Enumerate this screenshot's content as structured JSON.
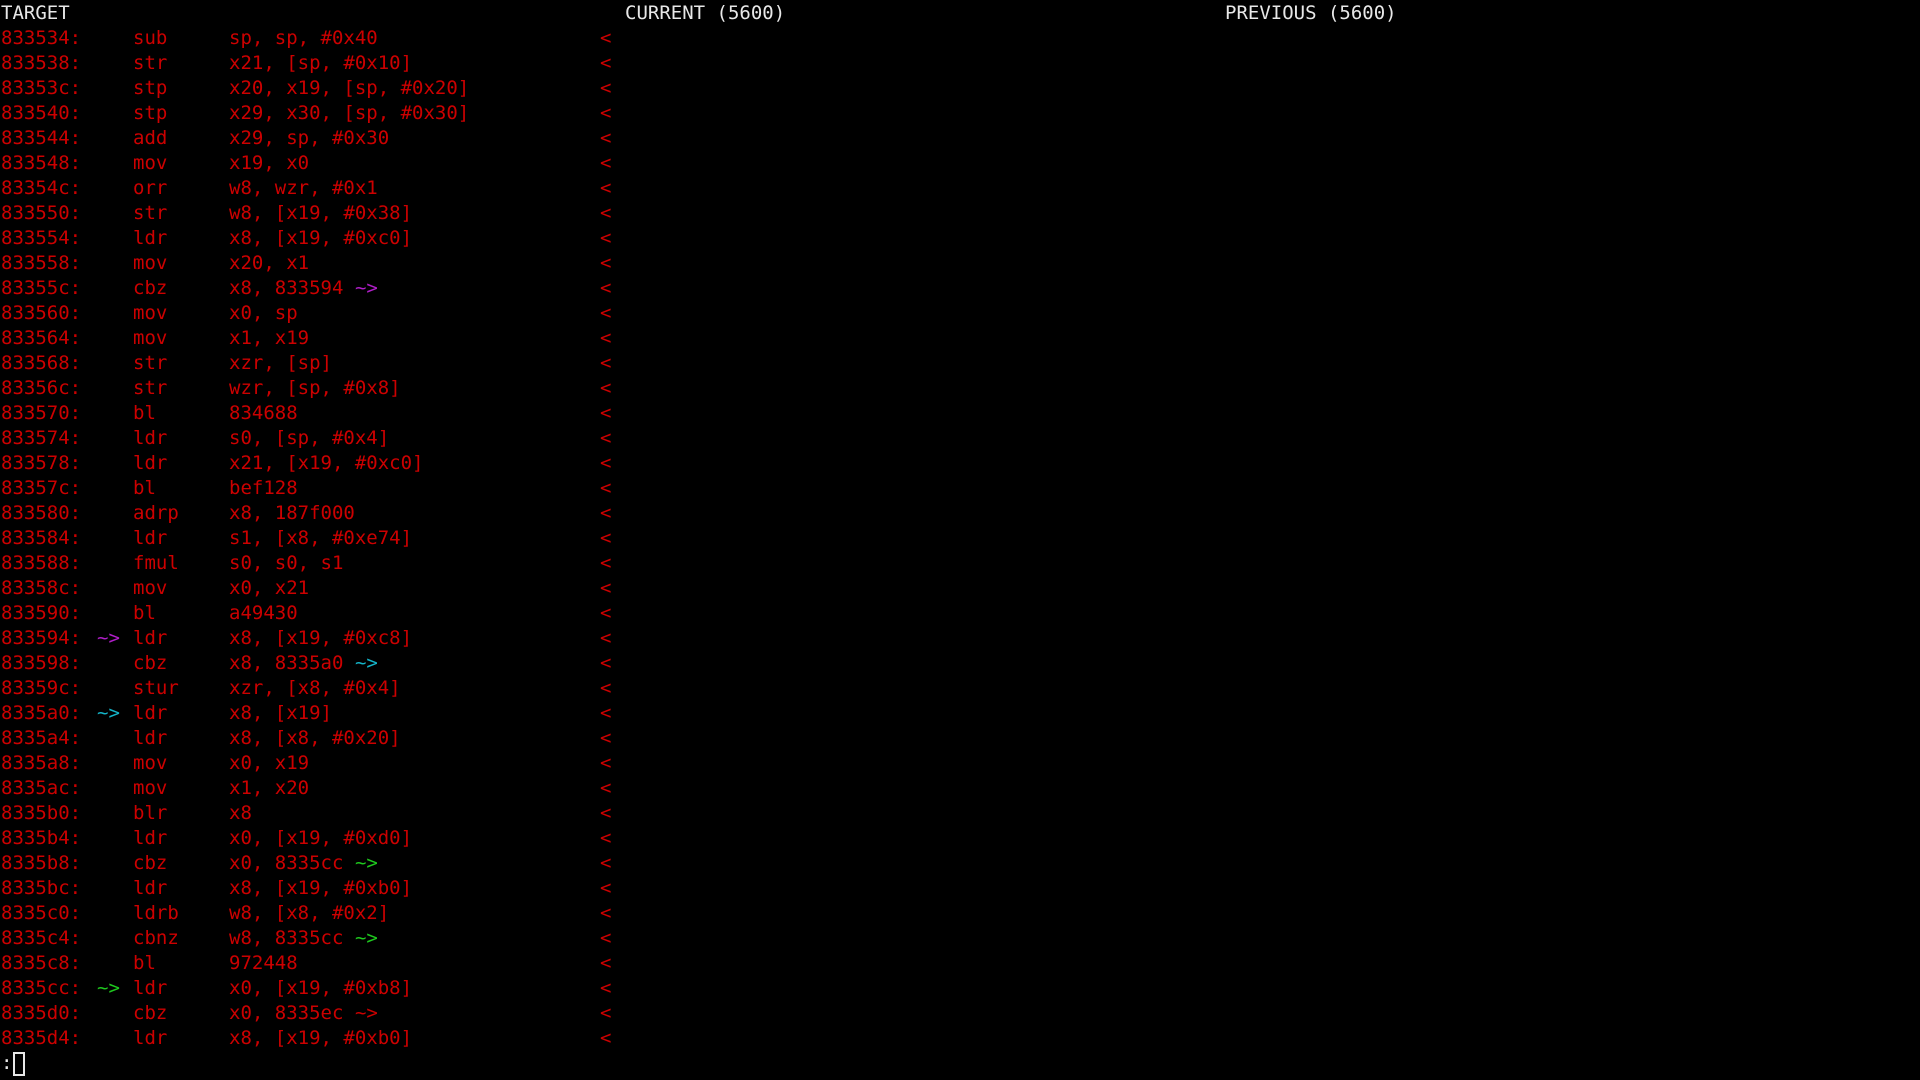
{
  "headers": {
    "target": "TARGET",
    "current": "CURRENT (5600)",
    "previous": "PREVIOUS (5600)"
  },
  "colors": {
    "text": "#cc0000",
    "header": "#e8e8e8",
    "arrow_purple": "#b01ec8",
    "arrow_cyan": "#14b4c8",
    "arrow_green": "#1ec81e"
  },
  "rows": [
    {
      "addr": "833534:",
      "mn": "sub",
      "op": "sp, sp, #0x40"
    },
    {
      "addr": "833538:",
      "mn": "str",
      "op": "x21, [sp, #0x10]"
    },
    {
      "addr": "83353c:",
      "mn": "stp",
      "op": "x20, x19, [sp, #0x20]"
    },
    {
      "addr": "833540:",
      "mn": "stp",
      "op": "x29, x30, [sp, #0x30]"
    },
    {
      "addr": "833544:",
      "mn": "add",
      "op": "x29, sp, #0x30"
    },
    {
      "addr": "833548:",
      "mn": "mov",
      "op": "x19, x0"
    },
    {
      "addr": "83354c:",
      "mn": "orr",
      "op": "w8, wzr, #0x1"
    },
    {
      "addr": "833550:",
      "mn": "str",
      "op": "w8, [x19, #0x38]"
    },
    {
      "addr": "833554:",
      "mn": "ldr",
      "op": "x8, [x19, #0xc0]"
    },
    {
      "addr": "833558:",
      "mn": "mov",
      "op": "x20, x1"
    },
    {
      "addr": "83355c:",
      "mn": "cbz",
      "op": "x8, 833594",
      "tail": " ~>",
      "tail_color": "arrow_purple"
    },
    {
      "addr": "833560:",
      "mn": "mov",
      "op": "x0, sp"
    },
    {
      "addr": "833564:",
      "mn": "mov",
      "op": "x1, x19"
    },
    {
      "addr": "833568:",
      "mn": "str",
      "op": "xzr, [sp]"
    },
    {
      "addr": "83356c:",
      "mn": "str",
      "op": "wzr, [sp, #0x8]"
    },
    {
      "addr": "833570:",
      "mn": "bl",
      "op": "834688"
    },
    {
      "addr": "833574:",
      "mn": "ldr",
      "op": "s0, [sp, #0x4]"
    },
    {
      "addr": "833578:",
      "mn": "ldr",
      "op": "x21, [x19, #0xc0]"
    },
    {
      "addr": "83357c:",
      "mn": "bl",
      "op": "bef128"
    },
    {
      "addr": "833580:",
      "mn": "adrp",
      "op": "x8, 187f000"
    },
    {
      "addr": "833584:",
      "mn": "ldr",
      "op": "s1, [x8, #0xe74]"
    },
    {
      "addr": "833588:",
      "mn": "fmul",
      "op": "s0, s0, s1"
    },
    {
      "addr": "83358c:",
      "mn": "mov",
      "op": "x0, x21"
    },
    {
      "addr": "833590:",
      "mn": "bl",
      "op": "a49430"
    },
    {
      "addr": "833594:",
      "arrow": "~>",
      "arrow_color": "arrow_purple",
      "mn": "ldr",
      "op": "x8, [x19, #0xc8]"
    },
    {
      "addr": "833598:",
      "mn": "cbz",
      "op": "x8, 8335a0",
      "tail": " ~>",
      "tail_color": "arrow_cyan"
    },
    {
      "addr": "83359c:",
      "mn": "stur",
      "op": "xzr, [x8, #0x4]"
    },
    {
      "addr": "8335a0:",
      "arrow": "~>",
      "arrow_color": "arrow_cyan",
      "mn": "ldr",
      "op": "x8, [x19]"
    },
    {
      "addr": "8335a4:",
      "mn": "ldr",
      "op": "x8, [x8, #0x20]"
    },
    {
      "addr": "8335a8:",
      "mn": "mov",
      "op": "x0, x19"
    },
    {
      "addr": "8335ac:",
      "mn": "mov",
      "op": "x1, x20"
    },
    {
      "addr": "8335b0:",
      "mn": "blr",
      "op": "x8"
    },
    {
      "addr": "8335b4:",
      "mn": "ldr",
      "op": "x0, [x19, #0xd0]"
    },
    {
      "addr": "8335b8:",
      "mn": "cbz",
      "op": "x0, 8335cc",
      "tail": " ~>",
      "tail_color": "arrow_green"
    },
    {
      "addr": "8335bc:",
      "mn": "ldr",
      "op": "x8, [x19, #0xb0]"
    },
    {
      "addr": "8335c0:",
      "mn": "ldrb",
      "op": "w8, [x8, #0x2]"
    },
    {
      "addr": "8335c4:",
      "mn": "cbnz",
      "op": "w8, 8335cc",
      "tail": " ~>",
      "tail_color": "arrow_green"
    },
    {
      "addr": "8335c8:",
      "mn": "bl",
      "op": "972448"
    },
    {
      "addr": "8335cc:",
      "arrow": "~>",
      "arrow_color": "arrow_green",
      "mn": "ldr",
      "op": "x0, [x19, #0xb8]"
    },
    {
      "addr": "8335d0:",
      "mn": "cbz",
      "op": "x0, 8335ec",
      "tail": " ~>",
      "tail_color": "text"
    },
    {
      "addr": "8335d4:",
      "mn": "ldr",
      "op": "x8, [x19, #0xb0]"
    }
  ],
  "diff_marker": "<",
  "prompt": ":"
}
